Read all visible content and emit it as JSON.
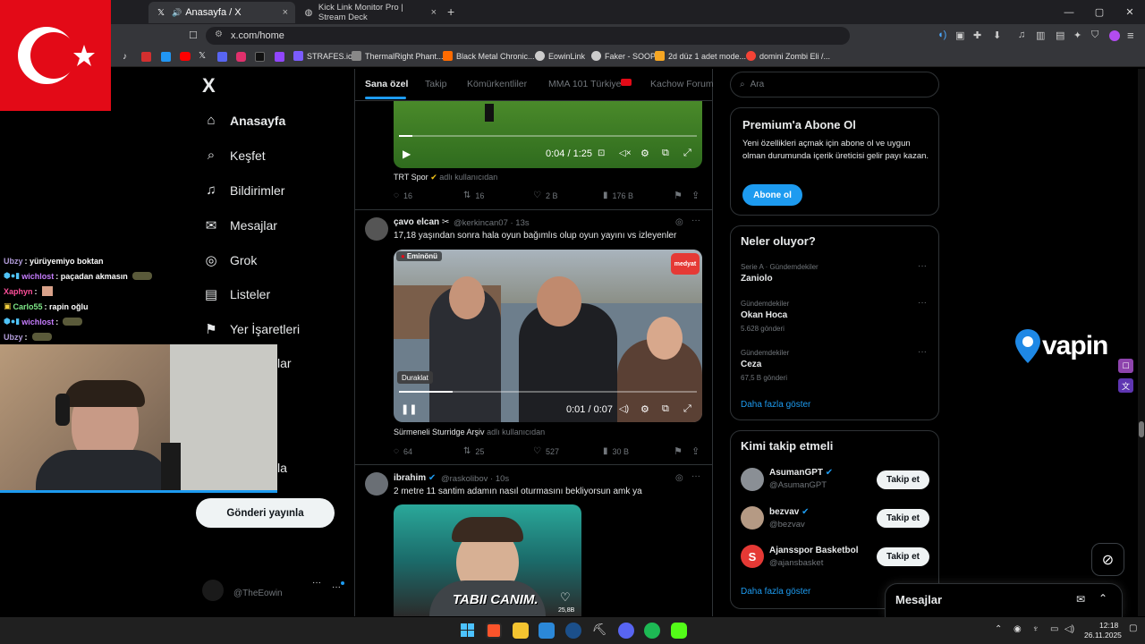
{
  "browser": {
    "tabs": [
      {
        "title": "Anasayfa / X",
        "close": "×"
      },
      {
        "title": "Kick Link Monitor Pro | Stream Deck",
        "close": "×"
      }
    ],
    "new_tab": "+",
    "url": "x.com/home",
    "win_controls": [
      "—",
      "▢",
      "✕"
    ],
    "bookmarks": [
      {
        "label": "STRAFES.io",
        "color": "#7b5cff"
      },
      {
        "label": "ThermalRight Phant...",
        "color": "#888888"
      },
      {
        "label": "Black Metal Chronic...",
        "color": "#ff6b00"
      },
      {
        "label": "EowinLink",
        "color": "#cccccc"
      },
      {
        "label": "Faker - SOOP",
        "color": "#cccccc"
      },
      {
        "label": "2d düz 1 adet mode...",
        "color": "#f5a623"
      },
      {
        "label": "domini Zombi Eli /...",
        "color": "#f44336"
      }
    ]
  },
  "nav": {
    "logo": "X",
    "items": [
      {
        "label": "Anasayfa",
        "icon": "⌂"
      },
      {
        "label": "Keşfet",
        "icon": "⌕"
      },
      {
        "label": "Bildirimler",
        "icon": "♫"
      },
      {
        "label": "Mesajlar",
        "icon": "✉"
      },
      {
        "label": "Grok",
        "icon": "◎"
      },
      {
        "label": "Listeler",
        "icon": "▤"
      },
      {
        "label": "Yer İşaretleri",
        "icon": "⚑"
      }
    ],
    "partial": [
      "lar",
      "la"
    ],
    "post_button": "Gönderi yayınla",
    "account_handle": "@TheEowin",
    "account_more": "···"
  },
  "chat": [
    {
      "user": "Ubzy",
      "color": "#b39ddb",
      "msg": ": yürüyemiyo boktan"
    },
    {
      "user": "wichlost",
      "color": "#c77dff",
      "msg": ": paçadan akmasın"
    },
    {
      "user": "Xaphyn",
      "color": "#ff4f9a",
      "msg": ":"
    },
    {
      "user": "Carlo55",
      "color": "#7ee787",
      "msg": ": rapin oğlu"
    },
    {
      "user": "wichlost",
      "color": "#c77dff",
      "msg": ":"
    },
    {
      "user": "Ubzy",
      "color": "#b39ddb",
      "msg": ":"
    }
  ],
  "feed": {
    "tabs": [
      "Sana özel",
      "Takip",
      "Kömürkentliler",
      "MMA 101 Türkiye",
      "Kachow Forum"
    ],
    "post1": {
      "time": "0:04 / 1:25",
      "source": "TRT Spor",
      "source_suffix": "adlı kullanıcıdan",
      "stats": [
        "16",
        "16",
        "2 B",
        "176 B"
      ]
    },
    "post2": {
      "name": "çavo elcan",
      "handle": "@kerkincan07 · 13s",
      "text": "17,18 yaşından sonra hala oyun bağımlıs olup oyun yayını vs izleyenler",
      "location_badge": "Eminönü",
      "brand_badge": "medyat",
      "tooltip": "Duraklat",
      "time": "0:01 / 0:07",
      "source": "Sürmeneli Sturridge Arşiv",
      "source_suffix": "adlı kullanıcıdan",
      "stats": [
        "64",
        "25",
        "527",
        "30 B"
      ]
    },
    "post3": {
      "name": "ibrahim",
      "handle": "@raskolibov · 10s",
      "text": "2 metre 11 santim adamın nasıl oturmasını bekliyorsun amk ya",
      "caption": "TABII CANIM.",
      "likes": "25,8B"
    }
  },
  "sidebar": {
    "search_placeholder": "Ara",
    "premium": {
      "title": "Premium'a Abone Ol",
      "text": "Yeni özellikleri açmak için abone ol ve uygun olman durumunda içerik üreticisi gelir payı kazan.",
      "button": "Abone ol"
    },
    "trends": {
      "title": "Neler oluyor?",
      "items": [
        {
          "meta": "Serie A · Gündemdekiler",
          "name": "Zaniolo",
          "count": ""
        },
        {
          "meta": "Gündemdekiler",
          "name": "Okan Hoca",
          "count": "5.628 gönderi"
        },
        {
          "meta": "Gündemdekiler",
          "name": "Ceza",
          "count": "67,5 B gönderi"
        }
      ],
      "more": "Daha fazla göster"
    },
    "who_to_follow": {
      "title": "Kimi takip etmeli",
      "items": [
        {
          "name": "AsumanGPT",
          "handle": "@AsumanGPT",
          "verified": true,
          "btn": "Takip et"
        },
        {
          "name": "bezvav",
          "handle": "@bezvav",
          "verified": true,
          "btn": "Takip et"
        },
        {
          "name": "Ajansspor Basketbol",
          "handle": "@ajansbasket",
          "verified": false,
          "btn": "Takip et"
        }
      ],
      "more": "Daha fazla göster"
    },
    "messages": "Mesajlar"
  },
  "overlay": {
    "logo": "vapin"
  },
  "clock": {
    "time": "12:18",
    "date": "26.11.2025"
  },
  "colors": {
    "accent": "#1d9bf0",
    "flag_red": "#e30a17"
  }
}
